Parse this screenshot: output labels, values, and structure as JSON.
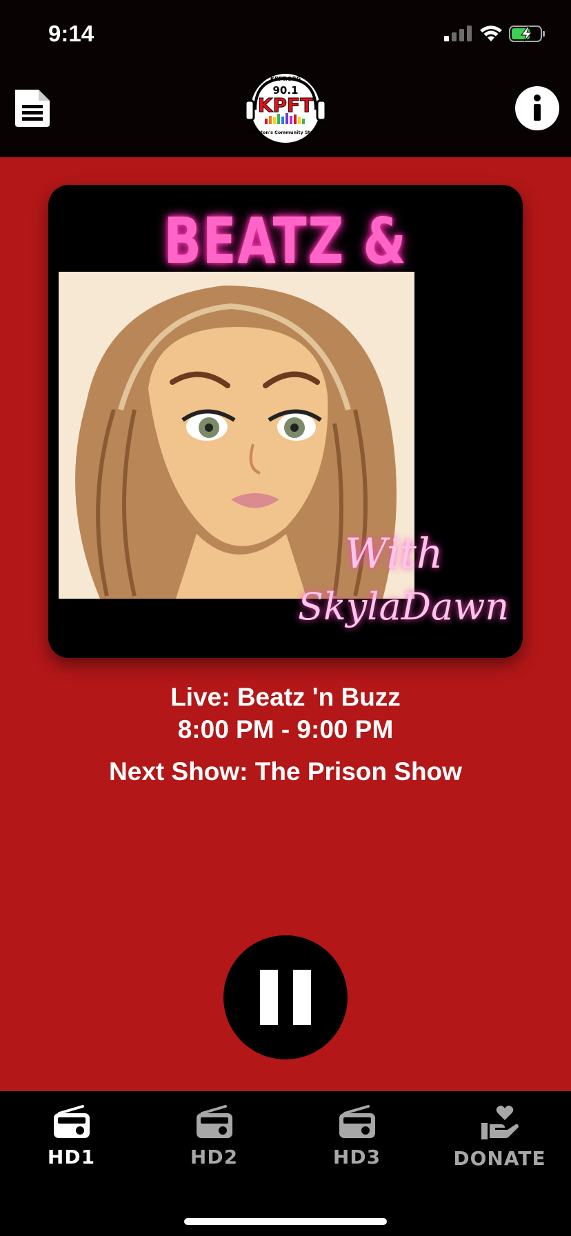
{
  "status": {
    "time": "9:14"
  },
  "header": {
    "left_icon": "document-icon",
    "logo": {
      "top": "KPFT.ORG",
      "freq": "90.1",
      "name": "KPFT",
      "tagline": "Houston's Community Station"
    },
    "right_icon": "info-icon"
  },
  "artwork": {
    "title": "BEATZ & BUZZ",
    "with": "With",
    "host": "SkylaDawn"
  },
  "now_playing": {
    "live": "Live: Beatz 'n Buzz",
    "time_range": "8:00 PM - 9:00 PM",
    "next": "Next Show: The Prison Show"
  },
  "player": {
    "state": "playing",
    "control_icon": "pause-icon"
  },
  "tabs": [
    {
      "label": "HD1",
      "icon": "radio-icon",
      "active": true
    },
    {
      "label": "HD2",
      "icon": "radio-icon",
      "active": false
    },
    {
      "label": "HD3",
      "icon": "radio-icon",
      "active": false
    },
    {
      "label": "DONATE",
      "icon": "donate-heart-hand-icon",
      "active": false
    }
  ],
  "colors": {
    "background": "#b31718",
    "bar": "#080203",
    "accent_pink": "#ff65c6",
    "tab_inactive": "#a7a7a7"
  }
}
